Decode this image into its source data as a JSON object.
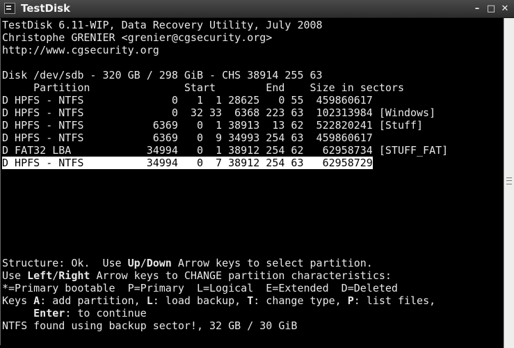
{
  "window": {
    "title": "TestDisk",
    "min_glyph": "–",
    "max_glyph": "□",
    "close_glyph": "✕"
  },
  "header": {
    "line1": "TestDisk 6.11-WIP, Data Recovery Utility, July 2008",
    "line2": "Christophe GRENIER <grenier@cgsecurity.org>",
    "line3": "http://www.cgsecurity.org"
  },
  "disk": {
    "info": "Disk /dev/sdb - 320 GB / 298 GiB - CHS 38914 255 63"
  },
  "table": {
    "header": "     Partition               Start        End    Size in sectors",
    "rows": [
      "D HPFS - NTFS              0   1  1 28625   0 55  459860617",
      "D HPFS - NTFS              0  32 33  6368 223 63  102313984 [Windows]",
      "D HPFS - NTFS           6369   0  1 38913  13 62  522820241 [Stuff]",
      "D HPFS - NTFS           6369   0  9 34993 254 63  459860617",
      "D FAT32 LBA            34994   0  1 38912 254 62   62958734 [STUFF_FAT]",
      "D HPFS - NTFS          34994   0  7 38912 254 63   62958729"
    ],
    "selected_index": 5
  },
  "help": {
    "l1_a": "Structure: Ok.  Use ",
    "l1_k1": "Up",
    "l1_sep": "/",
    "l1_k2": "Down",
    "l1_b": " Arrow keys to select partition.",
    "l2_a": "Use ",
    "l2_k1": "Left",
    "l2_sep": "/",
    "l2_k2": "Right",
    "l2_b": " Arrow keys to CHANGE partition characteristics:",
    "l3": "*=Primary bootable  P=Primary  L=Logical  E=Extended  D=Deleted",
    "l4_a": "Keys ",
    "l4_k1": "A",
    "l4_b": ": add partition, ",
    "l4_k2": "L",
    "l4_c": ": load backup, ",
    "l4_k3": "T",
    "l4_d": ": change type, ",
    "l4_k4": "P",
    "l4_e": ": list files,",
    "l5_indent": "     ",
    "l5_k": "Enter",
    "l5_b": ": to continue",
    "l6": "NTFS found using backup sector!, 32 GB / 30 GiB"
  }
}
